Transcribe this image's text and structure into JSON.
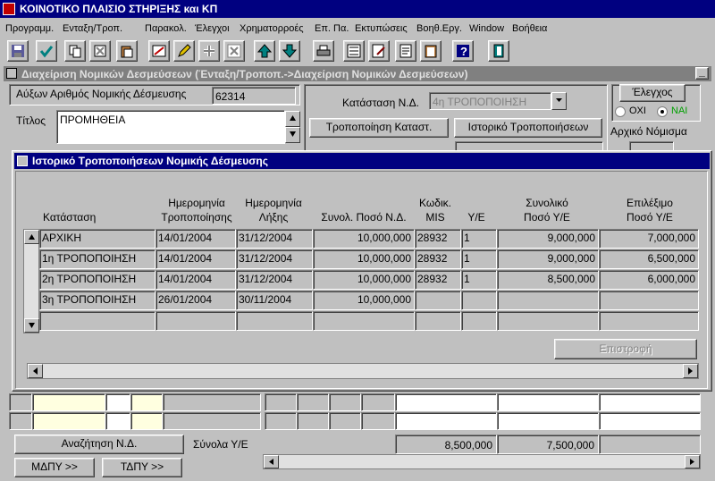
{
  "app": {
    "title": "ΚΟΙΝΟΤΙΚΟ ΠΛΑΙΣΙΟ ΣΤΗΡΙΞΗΣ και ΚΠ"
  },
  "menu": [
    "Προγραμμ.",
    "Ενταξη/Τροπ.",
    "Παρακολ.",
    "Έλεγχοι",
    "Χρηματορροές",
    "Επ. Πα.",
    "Εκτυπώσεις",
    "Βοηθ.Εργ.",
    "Window",
    "Βοήθεια"
  ],
  "toolbar": {
    "icons": [
      "save-icon",
      "check-icon",
      "copy-icon",
      "cut-icon",
      "paste-icon",
      "clear-form-icon",
      "edit-icon",
      "insert-record-icon",
      "delete-record-icon",
      "arrow-up-icon",
      "arrow-down-icon",
      "print-icon",
      "list-icon",
      "edit-document-icon",
      "document-icon",
      "clipboard-icon",
      "help-icon",
      "exit-icon"
    ],
    "help_label": "?"
  },
  "main_window": {
    "title": "Διαχείριση Νομικών Δεσμεύσεων (Ένταξη/Τροποπ.->Διαχείριση Νομικών Δεσμεύσεων)",
    "commitment_no_label": "Αύξων Αριθμός Νομικής Δέσμευσης",
    "commitment_no_value": "62314",
    "title_label": "Τίτλος",
    "title_value": "ΠΡΟΜΗΘΕΙΑ",
    "status_label": "Κατάσταση Ν.Δ.",
    "status_value": "4η ΤΡΟΠΟΠΟΙΗΣΗ",
    "modify_status_button": "Τροποποίηση Καταστ.",
    "history_button": "Ιστορικό Τροποποιήσεων",
    "checks_button": "Έλεγχος",
    "radio_no": "ΟΧΙ",
    "radio_yes": "ΝΑΙ",
    "original_currency_label": "Αρχικό Νόμισμα",
    "search_button": "Αναζήτηση Ν.Δ.",
    "totals_label": "Σύνολα Υ/Ε",
    "total_1": "8,500,000",
    "total_2": "7,500,000",
    "mdpy_button": "ΜΔΠΥ >>",
    "tdpy_button": "ΤΔΠΥ >>"
  },
  "dialog": {
    "title": "Ιστορικό Τροποποιήσεων Νομικής Δέσμευσης",
    "headers": {
      "status": "Κατάσταση",
      "mod_date_1": "Ημερομηνία",
      "mod_date_2": "Τροποποίησης",
      "exp_date_1": "Ημερομηνία",
      "exp_date_2": "Λήξης",
      "total_amount": "Συνολ. Ποσό Ν.Δ.",
      "mis_1": "Κωδικ.",
      "mis_2": "MIS",
      "ye": "Υ/Ε",
      "total_ye_1": "Συνολικό",
      "total_ye_2": "Ποσό Υ/Ε",
      "eligible_1": "Επιλέξιμο",
      "eligible_2": "Ποσό Υ/Ε"
    },
    "rows": [
      {
        "status": "ΑΡΧΙΚΗ",
        "mod_date": "14/01/2004",
        "exp_date": "31/12/2004",
        "total": "10,000,000",
        "mis": "28932",
        "ye": "1",
        "total_ye": "9,000,000",
        "eligible": "7,000,000"
      },
      {
        "status": "1η ΤΡΟΠΟΠΟΙΗΣΗ",
        "mod_date": "14/01/2004",
        "exp_date": "31/12/2004",
        "total": "10,000,000",
        "mis": "28932",
        "ye": "1",
        "total_ye": "9,000,000",
        "eligible": "6,500,000"
      },
      {
        "status": "2η ΤΡΟΠΟΠΟΙΗΣΗ",
        "mod_date": "14/01/2004",
        "exp_date": "31/12/2004",
        "total": "10,000,000",
        "mis": "28932",
        "ye": "1",
        "total_ye": "8,500,000",
        "eligible": "6,000,000"
      },
      {
        "status": "3η ΤΡΟΠΟΠΟΙΗΣΗ",
        "mod_date": "26/01/2004",
        "exp_date": "30/11/2004",
        "total": "10,000,000",
        "mis": "",
        "ye": "",
        "total_ye": "",
        "eligible": ""
      },
      {
        "status": "",
        "mod_date": "",
        "exp_date": "",
        "total": "",
        "mis": "",
        "ye": "",
        "total_ye": "",
        "eligible": ""
      }
    ],
    "return_button": "Επιστροφή"
  }
}
